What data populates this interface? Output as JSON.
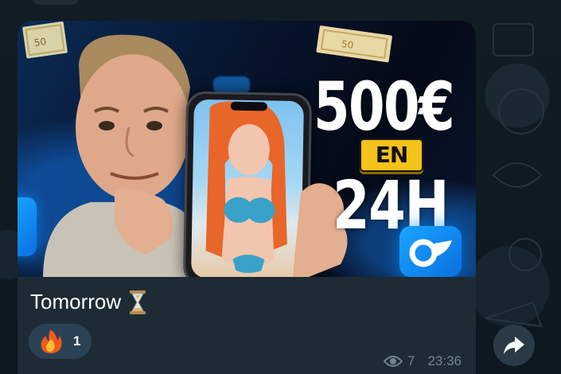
{
  "post": {
    "image": {
      "headline_amount": "500€",
      "headline_connector": "EN",
      "headline_time": "24H"
    },
    "caption": "Tomorrow",
    "caption_emoji_icon": "hourglass-icon",
    "reaction": {
      "emoji_icon": "fire-icon",
      "count": "1"
    },
    "views": "7",
    "time": "23:36"
  },
  "share_icon": "share-arrow-icon",
  "colors": {
    "bubble": "#1e2b35",
    "reaction_bg": "#2b4254",
    "accent_blue": "#1a8fff",
    "badge_yellow": "#f4c21a",
    "meta_text": "#6f8595"
  }
}
